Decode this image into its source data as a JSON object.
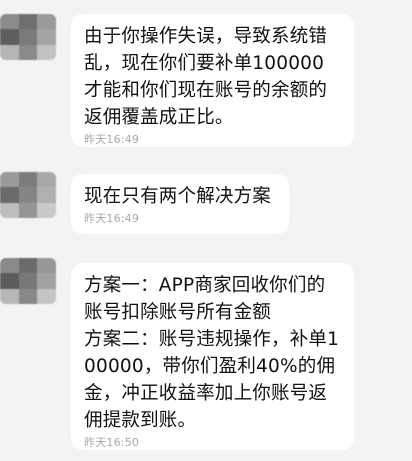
{
  "messages": [
    {
      "text": "由于你操作失误，导致系统错乱，现在你们要补单100000才能和你们现在账号的余额的返佣覆盖成正比。",
      "time": "昨天16:49"
    },
    {
      "text": "现在只有两个解决方案",
      "time": "昨天16:49"
    },
    {
      "text": "方案一：APP商家回收你们的账号扣除账号所有金额\n方案二：账号违规操作，补单100000，带你们盈利40%的佣金，冲正收益率加上你账号返佣提款到账。",
      "time": "昨天16:50"
    }
  ]
}
